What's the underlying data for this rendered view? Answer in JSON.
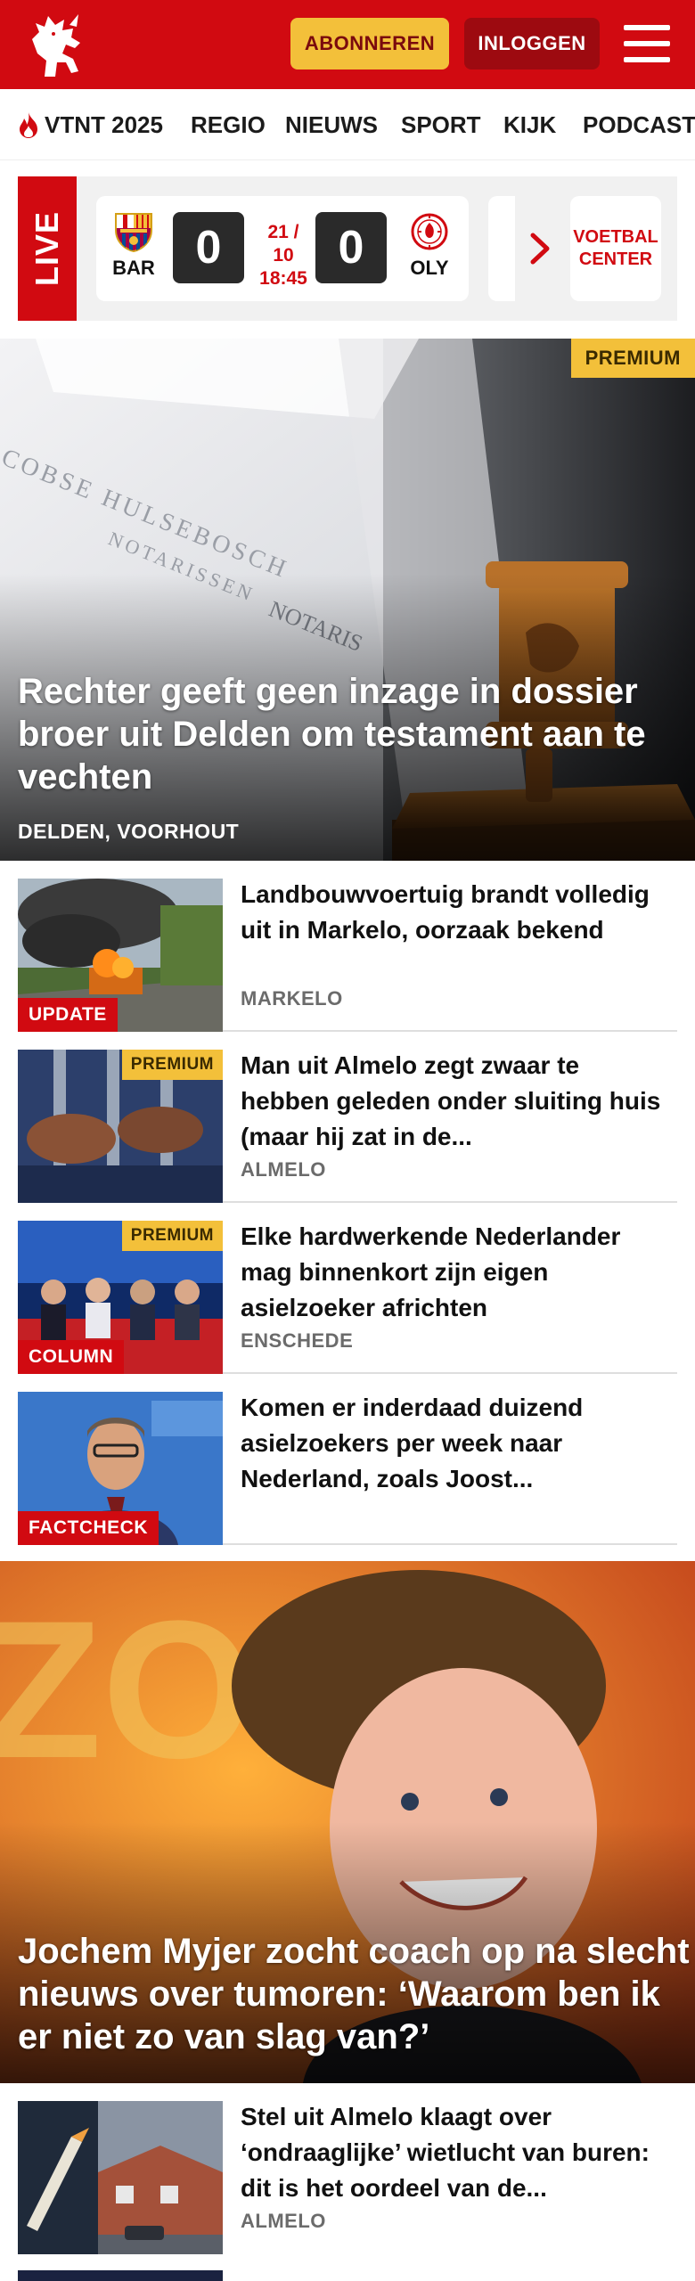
{
  "header": {
    "subscribe_label": "ABONNEREN",
    "login_label": "INLOGGEN",
    "colors": {
      "brand_red": "#d10a11",
      "accent_yellow": "#f3c03a"
    }
  },
  "nav": {
    "items": [
      {
        "label": "VTNT 2025",
        "icon": "flame-icon"
      },
      {
        "label": "REGIO"
      },
      {
        "label": "NIEUWS"
      },
      {
        "label": "SPORT"
      },
      {
        "label": "KIJK"
      },
      {
        "label": "PODCAST"
      }
    ]
  },
  "live": {
    "tag": "LIVE",
    "match": {
      "home": "BAR",
      "away": "OLY",
      "home_score": "0",
      "away_score": "0",
      "date": "21 / 10",
      "time": "18:45"
    },
    "voetbal_center_line1": "VOETBAL",
    "voetbal_center_line2": "CENTER"
  },
  "hero": {
    "badge": "PREMIUM",
    "title": "Rechter geeft geen inzage in dossier broer uit Delden om testament aan te vechten",
    "location": "DELDEN, VOORHOUT"
  },
  "articles": [
    {
      "title": "Landbouwvoertuig brandt volledig uit in Markelo, oorzaak bekend",
      "location": "MARKELO",
      "label": "UPDATE",
      "premium": ""
    },
    {
      "title": "Man uit Almelo zegt zwaar te hebben geleden onder sluiting huis (maar hij zat in de...",
      "location": "ALMELO",
      "label": "",
      "premium": "PREMIUM"
    },
    {
      "title": "Elke hardwerkende Nederlander mag binnenkort zijn eigen asielzoeker africhten",
      "location": "ENSCHEDE",
      "label": "COLUMN",
      "premium": "PREMIUM"
    },
    {
      "title": "Komen er inderdaad duizend asielzoekers per week naar Nederland, zoals Joost...",
      "location": "",
      "label": "FACTCHECK",
      "premium": ""
    }
  ],
  "hero2": {
    "title": "Jochem Myjer zocht coach op na slecht nieuws over tumoren: ‘Waarom ben ik er niet zo van slag van?’"
  },
  "articles2": [
    {
      "title": "Stel uit Almelo klaagt over ‘ondraaglijke’ wietlucht van buren: dit is het oordeel van de...",
      "location": "ALMELO"
    }
  ]
}
